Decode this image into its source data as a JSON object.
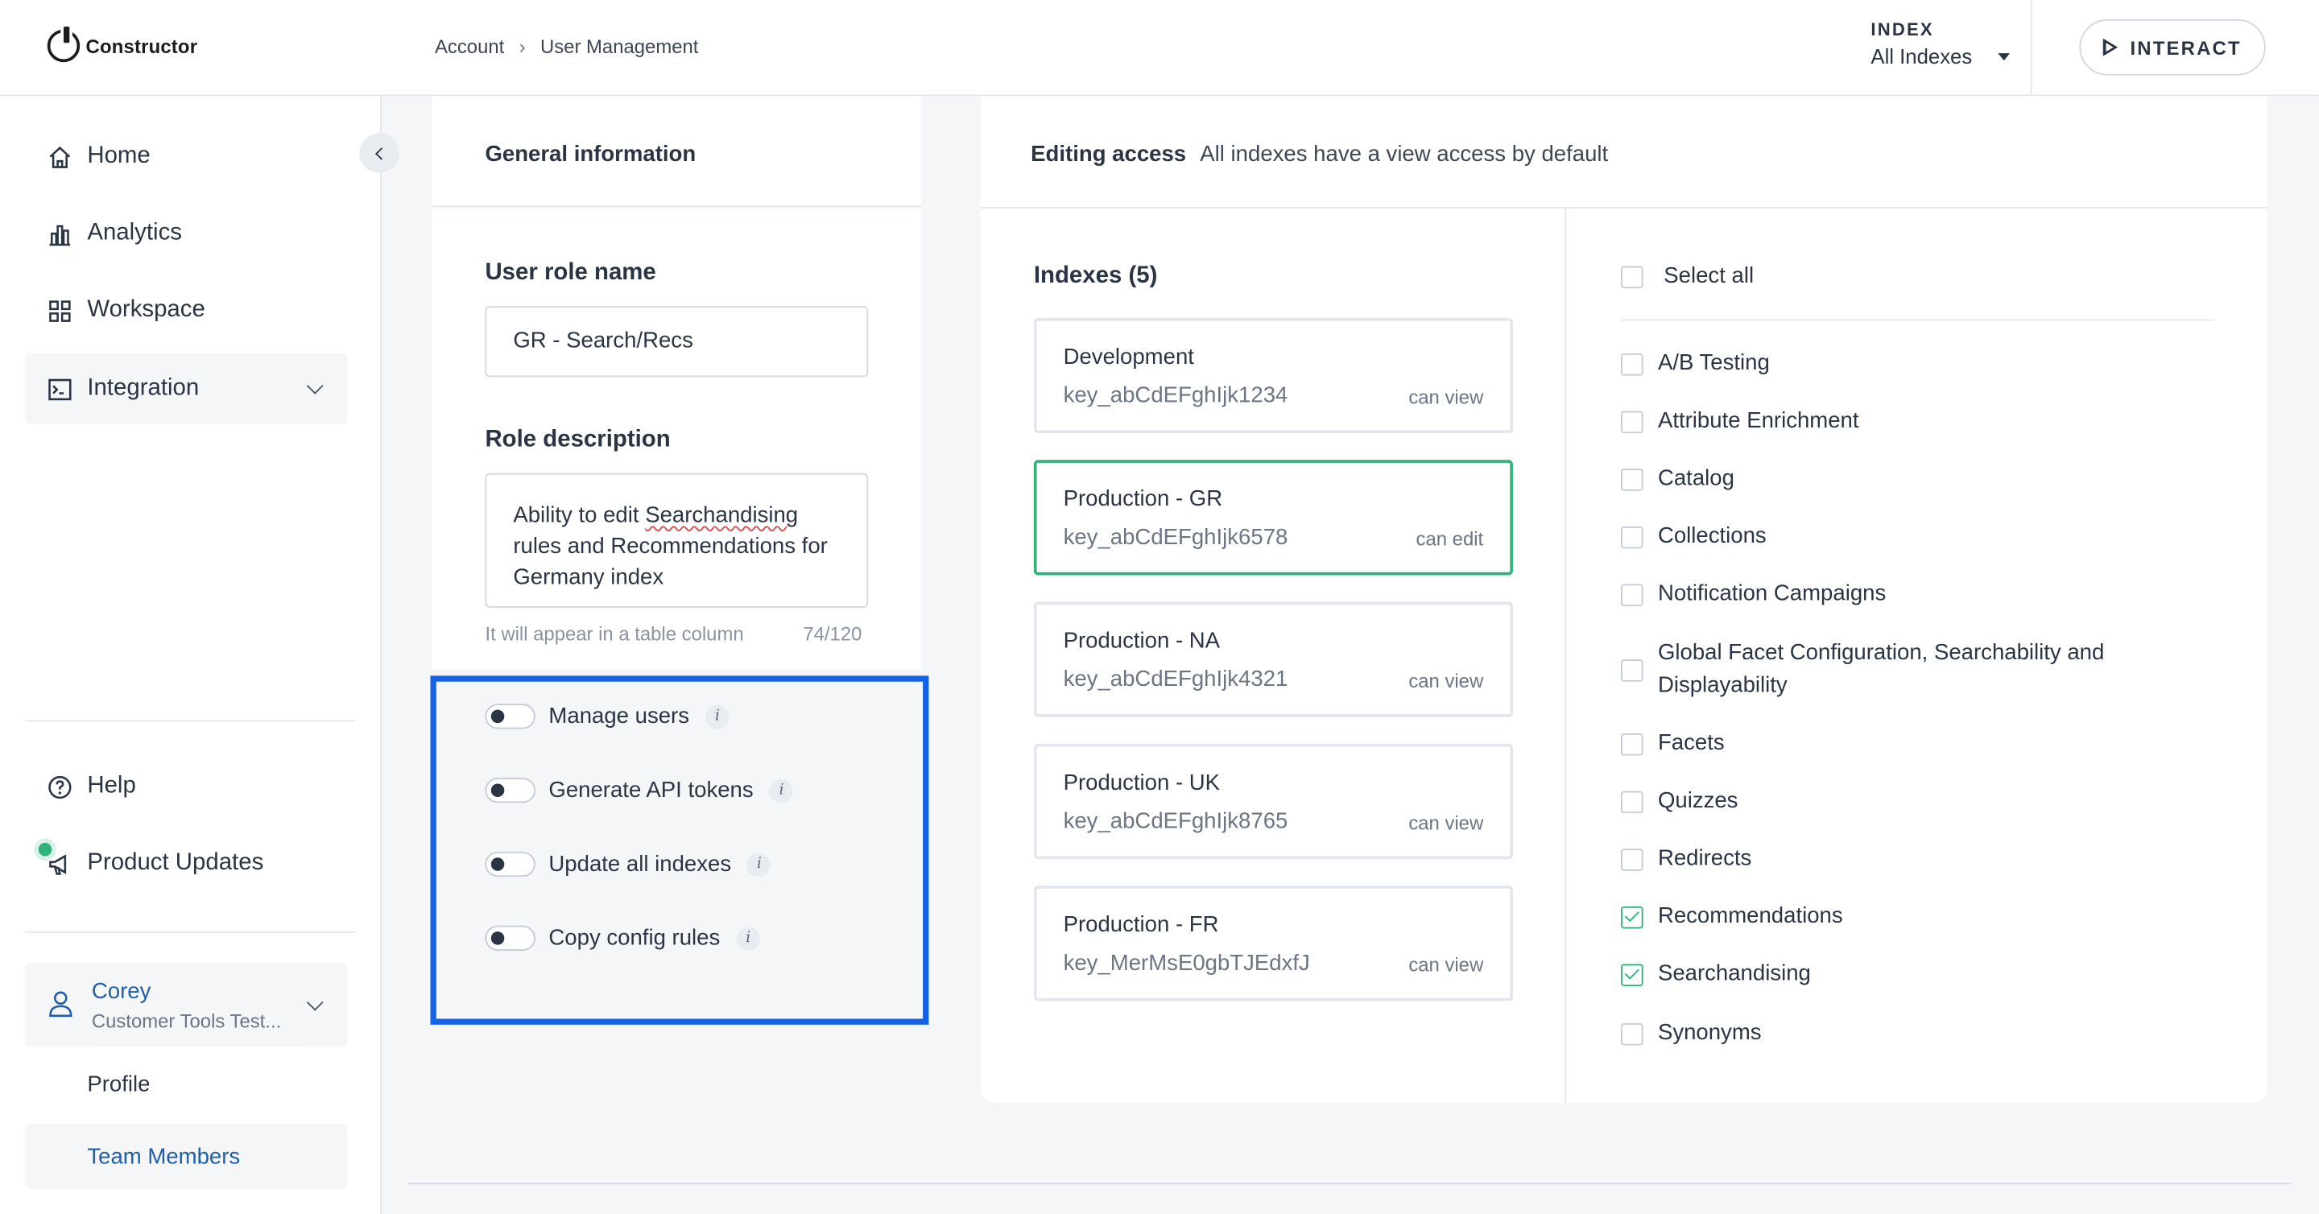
{
  "brand": {
    "name": "Constructor"
  },
  "breadcrumb": {
    "items": [
      "Account",
      "User Management"
    ]
  },
  "index_picker": {
    "label": "INDEX",
    "value": "All Indexes"
  },
  "interact": {
    "label": "INTERACT"
  },
  "sidebar": {
    "items": [
      {
        "label": "Home",
        "icon": "home-icon"
      },
      {
        "label": "Analytics",
        "icon": "analytics-icon"
      },
      {
        "label": "Workspace",
        "icon": "workspace-icon"
      },
      {
        "label": "Integration",
        "icon": "integration-icon"
      }
    ],
    "bottom_items": [
      {
        "label": "Help",
        "icon": "help-icon"
      },
      {
        "label": "Product Updates",
        "icon": "megaphone-icon"
      }
    ],
    "user": {
      "name": "Corey",
      "org": "Customer Tools Test..."
    },
    "sub_items": [
      "Profile",
      "Team Members"
    ]
  },
  "general": {
    "title": "General information",
    "role_name_label": "User role name",
    "role_name_value": "GR - Search/Recs",
    "role_desc_label": "Role description",
    "role_desc_pre": "Ability to edit ",
    "role_desc_word": "Searchandising",
    "role_desc_post": " rules and Recommendations for Germany index",
    "hint": "It will appear in a table column",
    "counter": "74/120",
    "toggles": [
      "Manage users",
      "Generate API tokens",
      "Update all indexes",
      "Copy config rules"
    ],
    "info_glyph": "i"
  },
  "editing": {
    "title": "Editing access",
    "subtitle": "All indexes have a view access by default",
    "indexes_label": "Indexes (5)",
    "indexes": [
      {
        "name": "Development",
        "key": "key_abCdEFghIjk1234",
        "perm": "can view"
      },
      {
        "name": "Production - GR",
        "key": "key_abCdEFghIjk6578",
        "perm": "can edit",
        "selected": true
      },
      {
        "name": "Production - NA",
        "key": "key_abCdEFghIjk4321",
        "perm": "can view"
      },
      {
        "name": "Production - UK",
        "key": "key_abCdEFghIjk8765",
        "perm": "can view"
      },
      {
        "name": "Production - FR",
        "key": "key_MerMsE0gbTJEdxfJ",
        "perm": "can view"
      }
    ],
    "select_all": "Select all",
    "permissions": [
      {
        "label": "A/B Testing",
        "checked": false
      },
      {
        "label": "Attribute Enrichment",
        "checked": false
      },
      {
        "label": "Catalog",
        "checked": false
      },
      {
        "label": "Collections",
        "checked": false
      },
      {
        "label": "Notification Campaigns",
        "checked": false
      },
      {
        "label": "Global Facet Configuration, Searchability and Displayability",
        "checked": false
      },
      {
        "label": "Facets",
        "checked": false
      },
      {
        "label": "Quizzes",
        "checked": false
      },
      {
        "label": "Redirects",
        "checked": false
      },
      {
        "label": "Recommendations",
        "checked": true
      },
      {
        "label": "Searchandising",
        "checked": true
      },
      {
        "label": "Synonyms",
        "checked": false
      }
    ]
  },
  "colors": {
    "accent_green": "#2fb37a",
    "highlight_blue": "#1463e6",
    "link_blue": "#1f5ea8",
    "text_dark": "#2b3445"
  }
}
